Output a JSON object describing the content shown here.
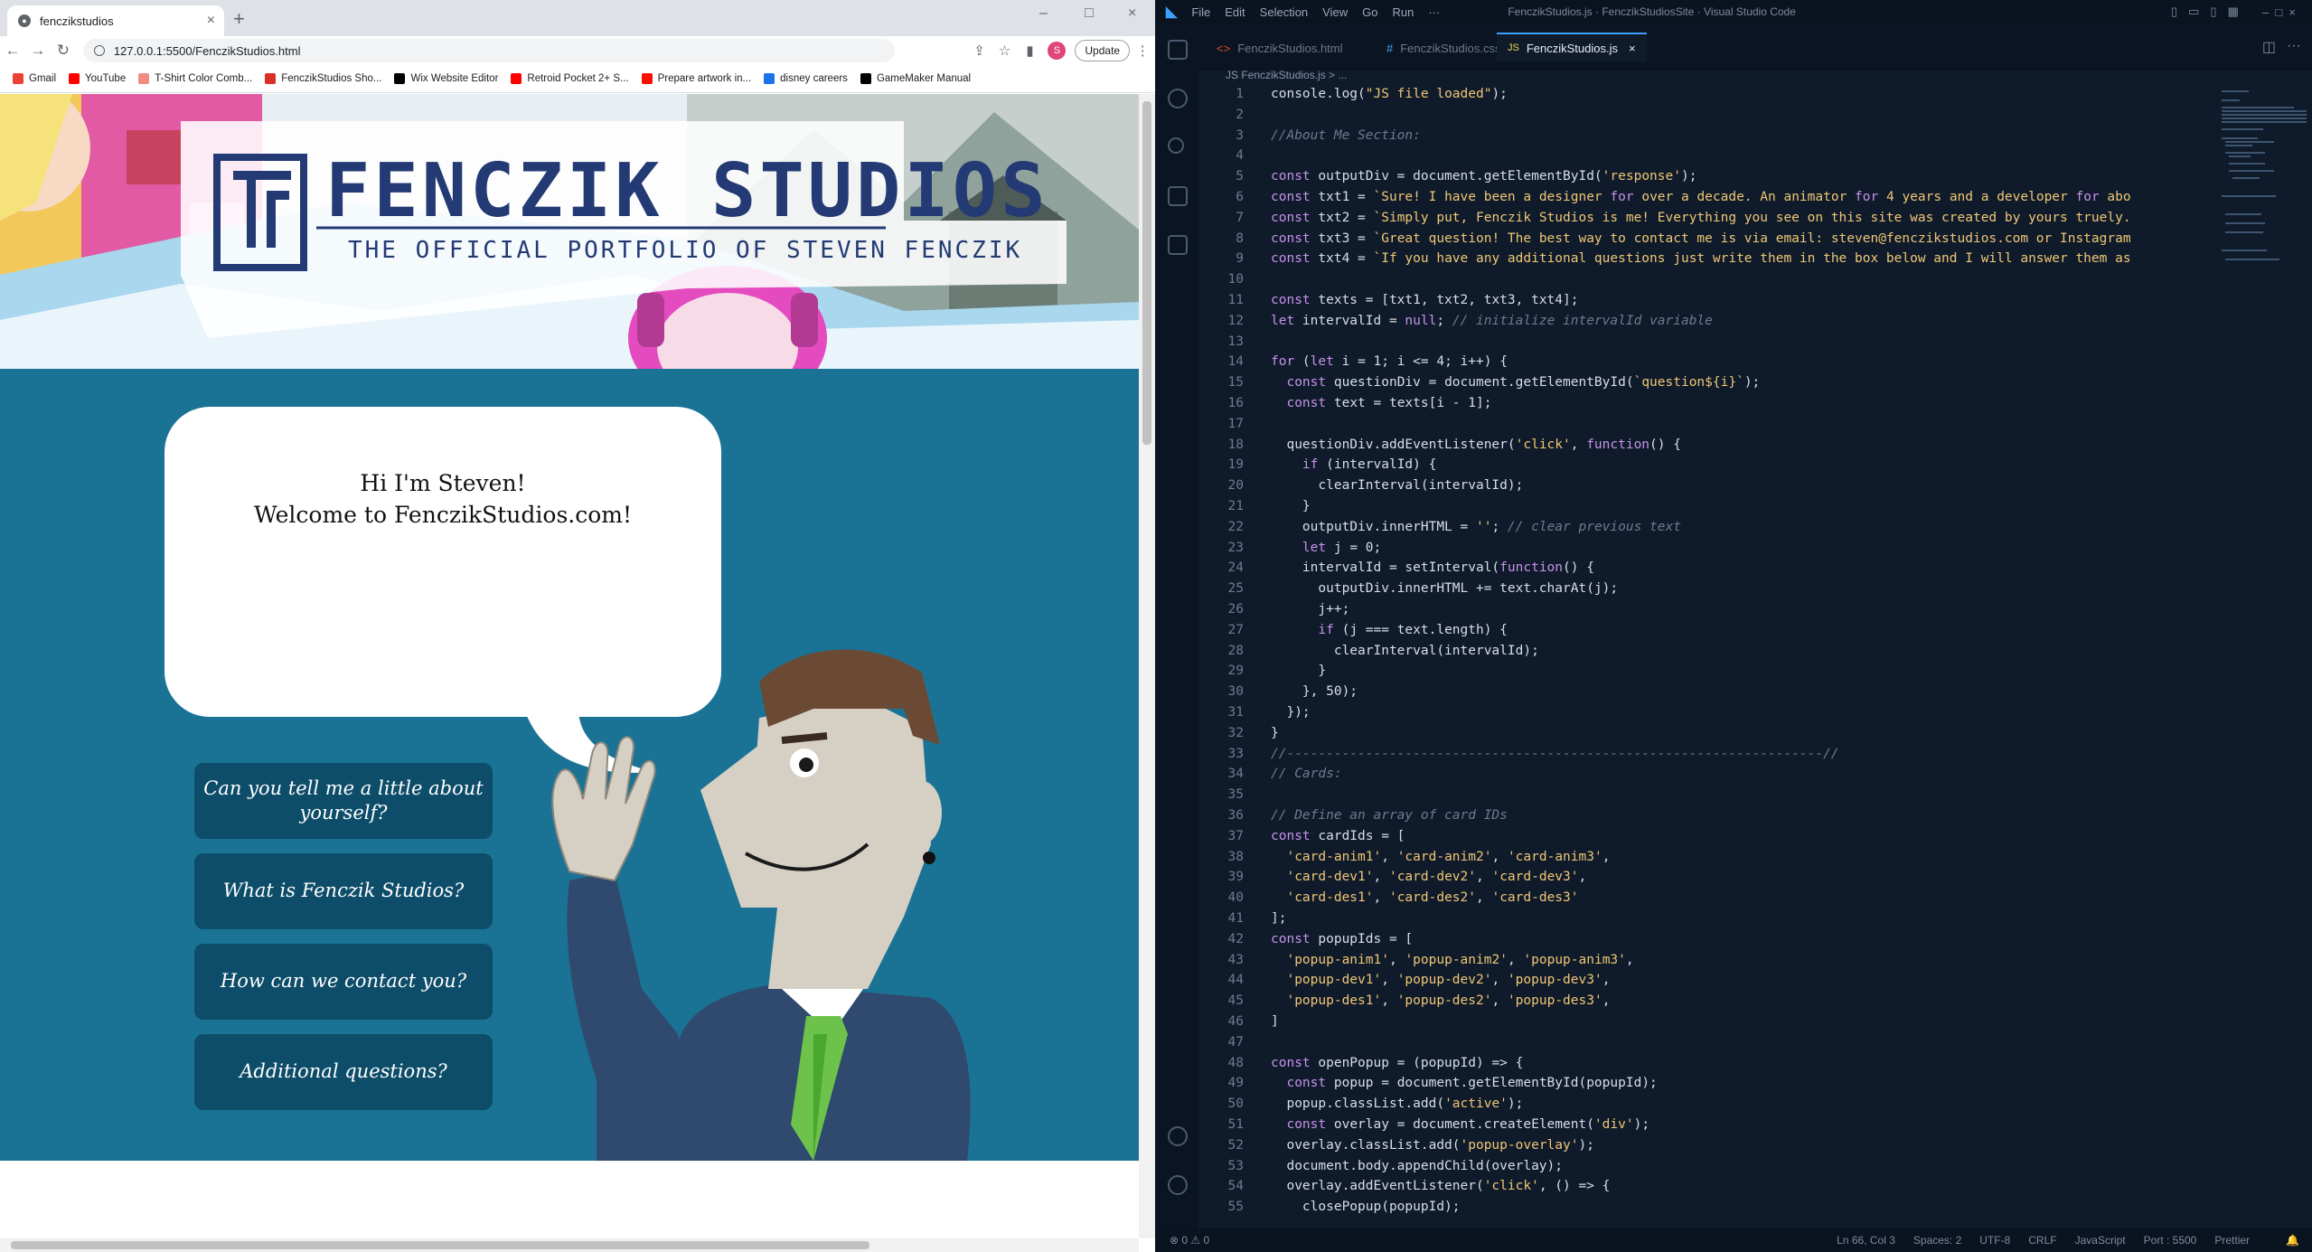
{
  "browser": {
    "tab_title": "fenczikstudios",
    "url": "127.0.0.1:5500/FenczikStudios.html",
    "update_label": "Update",
    "avatar_letter": "S",
    "bookmarks": [
      {
        "label": "Gmail",
        "color": "#ea4335"
      },
      {
        "label": "YouTube",
        "color": "#ff0000"
      },
      {
        "label": "T-Shirt Color Comb...",
        "color": "#f28b82"
      },
      {
        "label": "FenczikStudios Sho...",
        "color": "#d93025"
      },
      {
        "label": "Wix Website Editor",
        "color": "#000000"
      },
      {
        "label": "Retroid Pocket 2+ S...",
        "color": "#ff0000"
      },
      {
        "label": "Prepare artwork in...",
        "color": "#fa0f00"
      },
      {
        "label": "disney careers",
        "color": "#1a73e8"
      },
      {
        "label": "GameMaker Manual",
        "color": "#000000"
      }
    ]
  },
  "site": {
    "title": "FENCZIK STUDIOS",
    "subtitle": "THE OFFICIAL PORTFOLIO OF STEVEN FENCZIK",
    "bubble_line1": "Hi I'm Steven!",
    "bubble_line2": "Welcome to FenczikStudios.com!",
    "questions": [
      "Can you tell me a little about yourself?",
      "What is Fenczik Studios?",
      "How can we contact you?",
      "Additional questions?"
    ]
  },
  "vscode": {
    "menu": [
      "File",
      "Edit",
      "Selection",
      "View",
      "Go",
      "Run",
      "···"
    ],
    "window_title": "FenczikStudios.js · FenczikStudiosSite · Visual Studio Code",
    "tabs": [
      {
        "label": "FenczikStudios.html",
        "icon": "<>",
        "color": "#e44d26"
      },
      {
        "label": "FenczikStudios.css",
        "icon": "#",
        "color": "#42a5f5"
      },
      {
        "label": "FenczikStudios.js",
        "icon": "JS",
        "color": "#f0db4f"
      }
    ],
    "breadcrumb": "JS FenczikStudios.js > ...",
    "code_lines": [
      "console.log(\"JS file loaded\");",
      "",
      "//About Me Section:",
      "",
      "const outputDiv = document.getElementById('response');",
      "const txt1 = `Sure! I have been a designer for over a decade. An animator for 4 years and a developer for abo",
      "const txt2 = `Simply put, Fenczik Studios is me! Everything you see on this site was created by yours truely.",
      "const txt3 = `Great question! The best way to contact me is via email: steven@fenczikstudios.com or Instagram",
      "const txt4 = `If you have any additional questions just write them in the box below and I will answer them as",
      "",
      "const texts = [txt1, txt2, txt3, txt4];",
      "let intervalId = null; // initialize intervalId variable",
      "",
      "for (let i = 1; i <= 4; i++) {",
      "  const questionDiv = document.getElementById(`question${i}`);",
      "  const text = texts[i - 1];",
      "",
      "  questionDiv.addEventListener('click', function() {",
      "    if (intervalId) {",
      "      clearInterval(intervalId);",
      "    }",
      "    outputDiv.innerHTML = ''; // clear previous text",
      "    let j = 0;",
      "    intervalId = setInterval(function() {",
      "      outputDiv.innerHTML += text.charAt(j);",
      "      j++;",
      "      if (j === text.length) {",
      "        clearInterval(intervalId);",
      "      }",
      "    }, 50);",
      "  });",
      "}",
      "//--------------------------------------------------------------------//",
      "// Cards:",
      "",
      "// Define an array of card IDs",
      "const cardIds = [",
      "  'card-anim1', 'card-anim2', 'card-anim3',",
      "  'card-dev1', 'card-dev2', 'card-dev3',",
      "  'card-des1', 'card-des2', 'card-des3'",
      "];",
      "const popupIds = [",
      "  'popup-anim1', 'popup-anim2', 'popup-anim3',",
      "  'popup-dev1', 'popup-dev2', 'popup-dev3',",
      "  'popup-des1', 'popup-des2', 'popup-des3',",
      "]",
      "",
      "const openPopup = (popupId) => {",
      "  const popup = document.getElementById(popupId);",
      "  popup.classList.add('active');",
      "  const overlay = document.createElement('div');",
      "  overlay.classList.add('popup-overlay');",
      "  document.body.appendChild(overlay);",
      "  overlay.addEventListener('click', () => {",
      "    closePopup(popupId);"
    ],
    "status_right": [
      "Ln 66, Col 3",
      "Spaces: 2",
      "UTF-8",
      "CRLF",
      "JavaScript",
      "Port : 5500",
      "Prettier"
    ]
  }
}
